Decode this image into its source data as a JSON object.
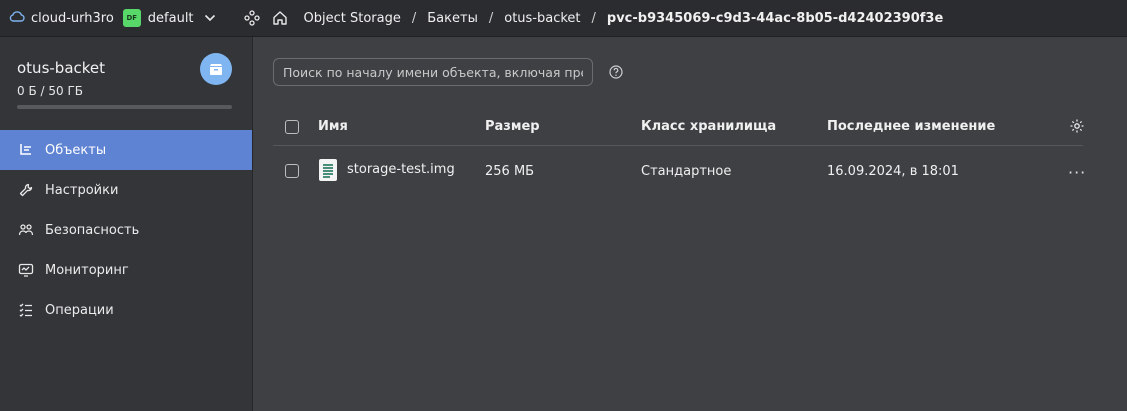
{
  "topbar": {
    "cloud_label": "cloud-urh3ro",
    "folder_badge": "DF",
    "folder_label": "default",
    "breadcrumbs": [
      "Object Storage",
      "Бакеты",
      "otus-backet",
      "pvc-b9345069-c9d3-44ac-8b05-d42402390f3e"
    ],
    "separator": "/"
  },
  "sidebar": {
    "bucket_name": "otus-backet",
    "bucket_size": "0 Б / 50 ГБ",
    "usage_fraction": 0,
    "items": [
      {
        "label": "Объекты",
        "icon": "objects-icon",
        "active": true
      },
      {
        "label": "Настройки",
        "icon": "wrench-icon",
        "active": false
      },
      {
        "label": "Безопасность",
        "icon": "users-icon",
        "active": false
      },
      {
        "label": "Мониторинг",
        "icon": "monitor-icon",
        "active": false
      },
      {
        "label": "Операции",
        "icon": "list-check-icon",
        "active": false
      }
    ]
  },
  "main": {
    "search_placeholder": "Поиск по началу имени объекта, включая префикс",
    "columns": {
      "name": "Имя",
      "size": "Размер",
      "storage_class": "Класс хранилища",
      "modified": "Последнее изменение"
    },
    "rows": [
      {
        "name": "storage-test.img",
        "size": "256 МБ",
        "storage_class": "Стандартное",
        "modified": "16.09.2024, в 18:01"
      }
    ],
    "row_menu": "···"
  },
  "colors": {
    "accent": "#5f83d3",
    "folder_badge": "#59d86a",
    "avatar": "#7fb6f2"
  }
}
